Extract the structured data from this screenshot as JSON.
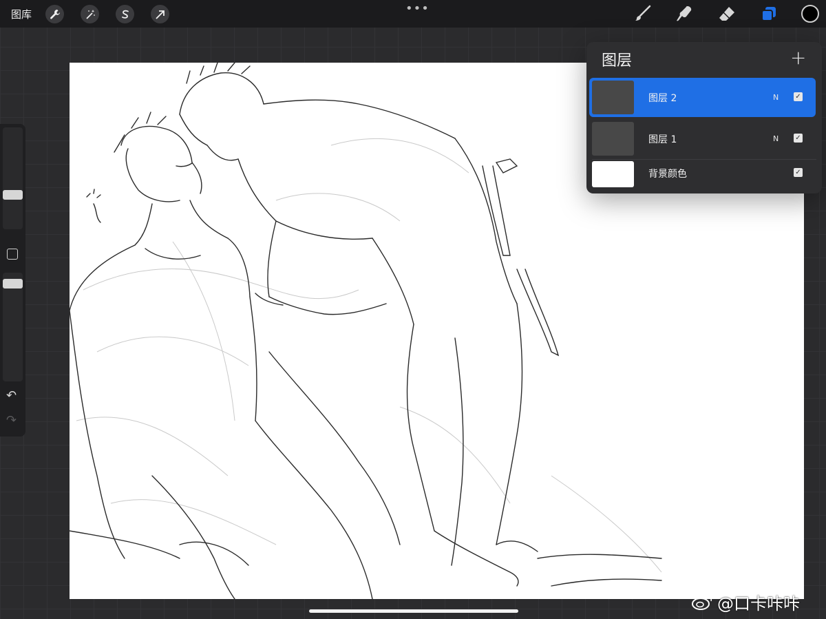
{
  "toolbar": {
    "gallery_label": "图库",
    "left_icons": [
      "wrench-icon",
      "magic-wand-icon",
      "selection-s-icon",
      "transform-arrow-icon"
    ],
    "more_label": "•••",
    "right_icons": [
      "brush-icon",
      "smudge-icon",
      "eraser-icon",
      "layers-icon"
    ],
    "accent_color": "#1f6fe5",
    "current_color": "#000000"
  },
  "sidebar": {
    "undo_label": "↶",
    "redo_label": "↷"
  },
  "layers_panel": {
    "title": "图层",
    "add_label": "+",
    "layers": [
      {
        "name": "图层 2",
        "blend_mode": "N",
        "visible": true,
        "active": true
      },
      {
        "name": "图层 1",
        "blend_mode": "N",
        "visible": true,
        "active": false
      },
      {
        "name": "背景颜色",
        "blend_mode": "",
        "visible": true,
        "active": false
      }
    ]
  },
  "watermark": {
    "text": "@口卡咔咔"
  }
}
